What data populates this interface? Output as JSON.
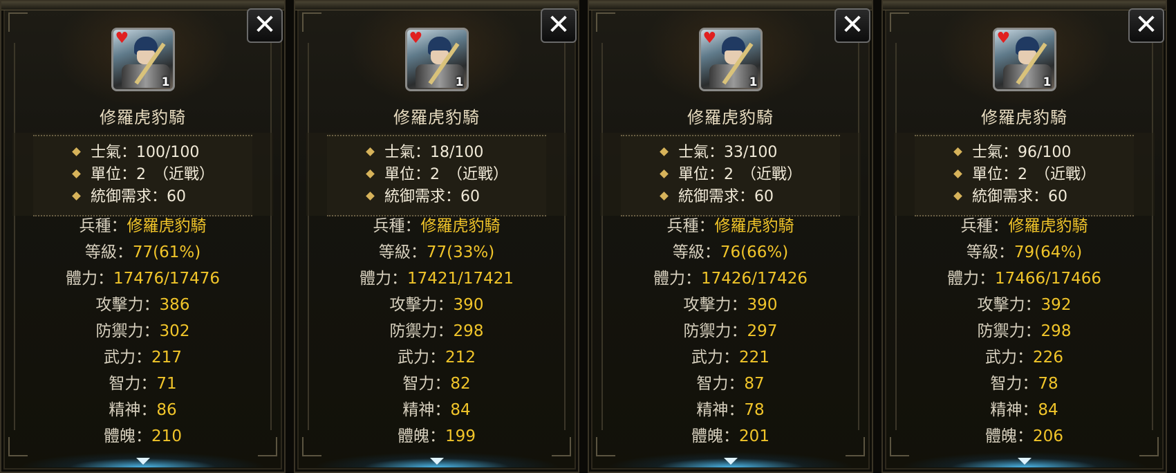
{
  "panels": [
    {
      "close_label": "✕",
      "portrait_level": "1",
      "unit_name": "修羅虎豹騎",
      "morale_label": "士氣：",
      "morale": "100/100",
      "units_label": "單位：",
      "units": "2　（近戰）",
      "command_label": "統御需求：",
      "command": "60",
      "type_label": "兵種：",
      "type": "修羅虎豹騎",
      "level_label": "等級：",
      "level": "77(61%)",
      "hp_label": "體力：",
      "hp": "17476/17476",
      "atk_label": "攻擊力：",
      "atk": "386",
      "def_label": "防禦力：",
      "def": "302",
      "str_label": "武力：",
      "str": "217",
      "int_label": "智力：",
      "int": "71",
      "spi_label": "精神：",
      "spi": "86",
      "con_label": "體魄：",
      "con": "210"
    },
    {
      "close_label": "✕",
      "portrait_level": "1",
      "unit_name": "修羅虎豹騎",
      "morale_label": "士氣：",
      "morale": "18/100",
      "units_label": "單位：",
      "units": "2　（近戰）",
      "command_label": "統御需求：",
      "command": "60",
      "type_label": "兵種：",
      "type": "修羅虎豹騎",
      "level_label": "等級：",
      "level": "77(33%)",
      "hp_label": "體力：",
      "hp": "17421/17421",
      "atk_label": "攻擊力：",
      "atk": "390",
      "def_label": "防禦力：",
      "def": "298",
      "str_label": "武力：",
      "str": "212",
      "int_label": "智力：",
      "int": "82",
      "spi_label": "精神：",
      "spi": "84",
      "con_label": "體魄：",
      "con": "199"
    },
    {
      "close_label": "✕",
      "portrait_level": "1",
      "unit_name": "修羅虎豹騎",
      "morale_label": "士氣：",
      "morale": "33/100",
      "units_label": "單位：",
      "units": "2　（近戰）",
      "command_label": "統御需求：",
      "command": "60",
      "type_label": "兵種：",
      "type": "修羅虎豹騎",
      "level_label": "等級：",
      "level": "76(66%)",
      "hp_label": "體力：",
      "hp": "17426/17426",
      "atk_label": "攻擊力：",
      "atk": "390",
      "def_label": "防禦力：",
      "def": "297",
      "str_label": "武力：",
      "str": "221",
      "int_label": "智力：",
      "int": "87",
      "spi_label": "精神：",
      "spi": "78",
      "con_label": "體魄：",
      "con": "201"
    },
    {
      "close_label": "✕",
      "portrait_level": "1",
      "unit_name": "修羅虎豹騎",
      "morale_label": "士氣：",
      "morale": "96/100",
      "units_label": "單位：",
      "units": "2　（近戰）",
      "command_label": "統御需求：",
      "command": "60",
      "type_label": "兵種：",
      "type": "修羅虎豹騎",
      "level_label": "等級：",
      "level": "79(64%)",
      "hp_label": "體力：",
      "hp": "17466/17466",
      "atk_label": "攻擊力：",
      "atk": "392",
      "def_label": "防禦力：",
      "def": "298",
      "str_label": "武力：",
      "str": "226",
      "int_label": "智力：",
      "int": "78",
      "spi_label": "精神：",
      "spi": "84",
      "con_label": "體魄：",
      "con": "206"
    }
  ],
  "colors": {
    "value_gold": "#f1c52a",
    "label": "#d7d0be",
    "bullet": "#d7b35a"
  },
  "icons": {
    "close": "close-icon",
    "heart": "heart-icon",
    "down": "down-arrow-icon"
  }
}
